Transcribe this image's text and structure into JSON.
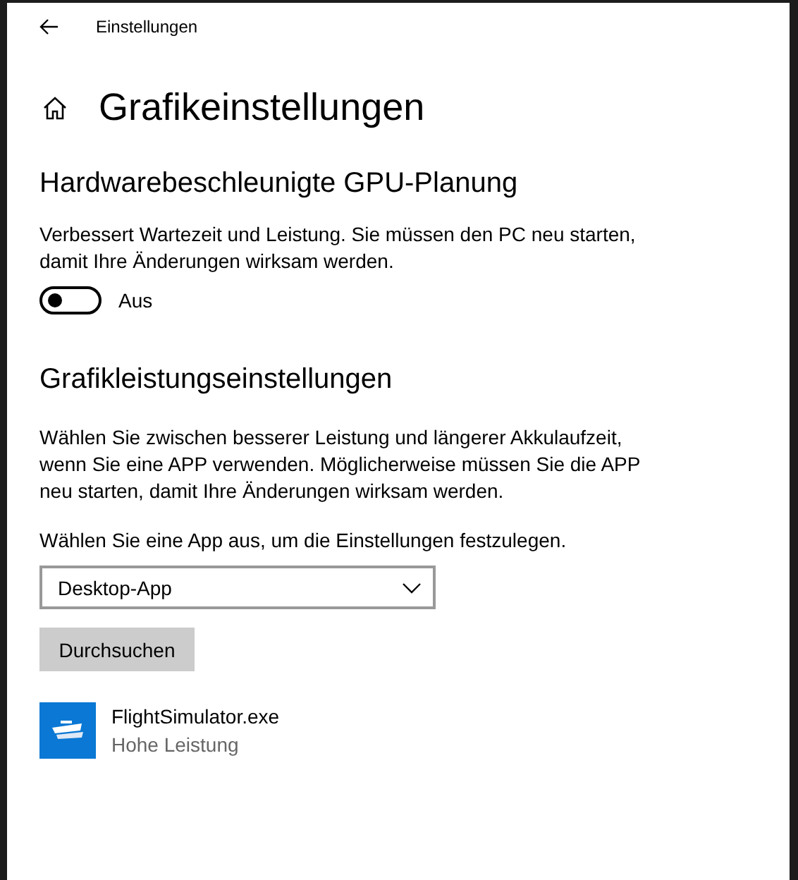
{
  "window": {
    "title": "Einstellungen"
  },
  "page": {
    "title": "Grafikeinstellungen"
  },
  "gpu_scheduling": {
    "heading": "Hardwarebeschleunigte GPU-Planung",
    "description": "Verbessert Wartezeit und Leistung. Sie müssen den PC neu starten, damit Ihre Änderungen wirksam werden.",
    "toggle": {
      "on": false,
      "label": "Aus"
    }
  },
  "graphics_performance": {
    "heading": "Grafikleistungseinstellungen",
    "description": "Wählen Sie zwischen besserer Leistung und längerer Akkulaufzeit, wenn Sie eine APP verwenden. Möglicherweise müssen Sie die APP neu starten, damit Ihre Änderungen wirksam werden.",
    "select_label": "Wählen Sie eine App aus, um die Einstellungen festzulegen.",
    "dropdown": {
      "value": "Desktop-App"
    },
    "browse_button": "Durchsuchen",
    "apps": [
      {
        "name": "FlightSimulator.exe",
        "preference": "Hohe Leistung"
      }
    ]
  }
}
